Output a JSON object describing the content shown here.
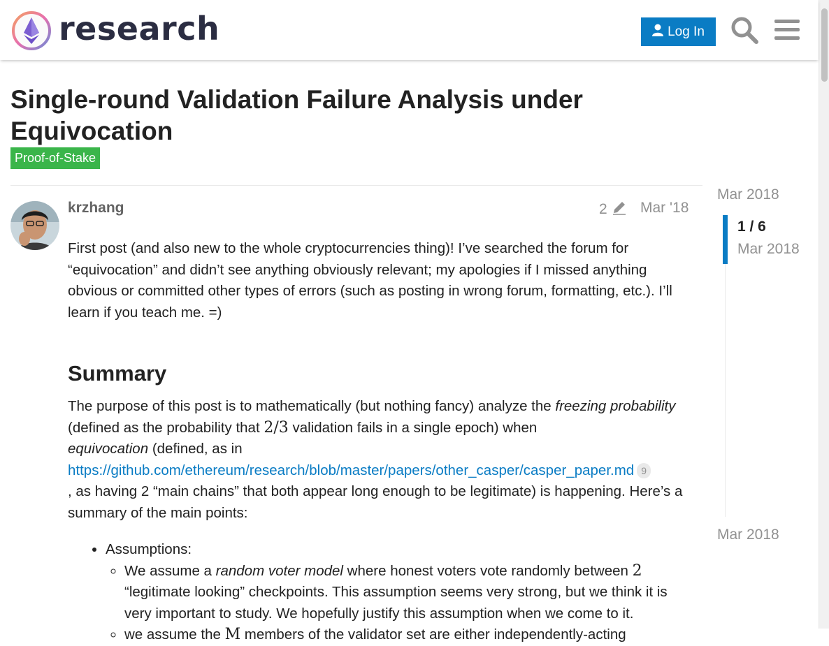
{
  "header": {
    "logo_text": "research",
    "login_label": "Log In",
    "search_icon": "search-icon",
    "menu_icon": "hamburger-menu-icon",
    "accent": "#0a7cc4"
  },
  "topic": {
    "title": "Single-round Validation Failure Analysis under Equivocation",
    "category": "Proof-of-Stake",
    "category_color": "#3ab54a"
  },
  "post": {
    "username": "krzhang",
    "edit_count": "2",
    "date": "Mar '18",
    "intro": "First post (and also new to the whole cryptocurrencies thing)! I’ve searched the forum for “equivocation” and didn’t see anything obviously relevant; my apologies if I missed anything obvious or committed other types of errors (such as posting in wrong forum, formatting, etc.). I’ll learn if you teach me. =)",
    "summary_heading": "Summary",
    "summary": {
      "t1": "The purpose of this post is to mathematically (but nothing fancy) analyze the ",
      "em1": "freezing probability",
      "t2": " (defined as the probability that ",
      "math1": "2/3",
      "t3": " validation fails in a single epoch) when ",
      "em2": "equivocation",
      "t4": " (defined, as in ",
      "link": "https://github.com/ethereum/research/blob/master/papers/other_casper/casper_paper.md",
      "link_clicks": "9",
      "t5": ", as having 2 “main chains” that both appear long enough to be legitimate) is happening. Here’s a summary of the main points:"
    },
    "assumptions_label": "Assumptions:",
    "a1": {
      "t1": "We assume a ",
      "em": "random voter model",
      "t2": " where honest voters vote randomly between ",
      "math": "2",
      "t3": " “legitimate looking” checkpoints. This assumption seems very strong, but we think it is very important to study. We hopefully justify this assumption when we come to it."
    },
    "a2": {
      "t1": "we assume the ",
      "math": "M",
      "t2": " members of the validator set are either independently-acting"
    }
  },
  "timeline": {
    "start_date": "Mar 2018",
    "position": "1 / 6",
    "current_date": "Mar 2018",
    "end_date": "Mar 2018"
  }
}
